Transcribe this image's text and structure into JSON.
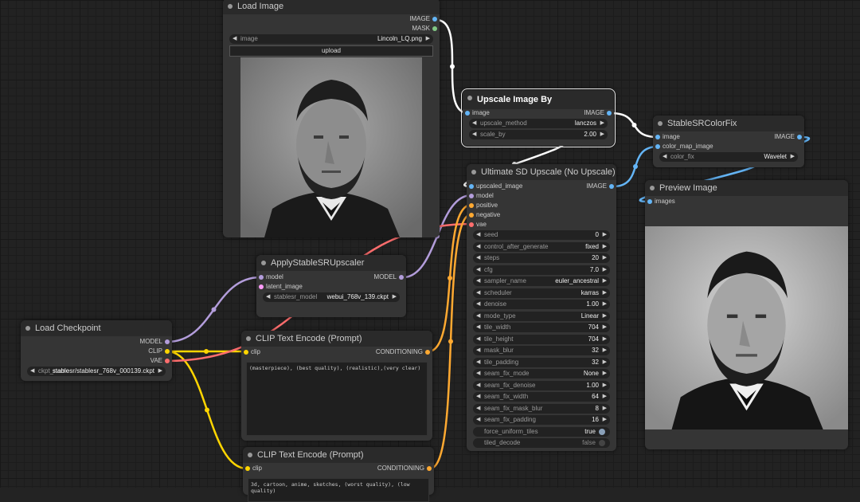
{
  "nodes": {
    "load_image": {
      "title": "Load Image",
      "outputs": [
        "IMAGE",
        "MASK"
      ],
      "image_widget": {
        "name": "image",
        "value": "Lincoln_LQ.png"
      },
      "upload_label": "upload"
    },
    "upscale_image_by": {
      "title": "Upscale Image By",
      "input": "image",
      "output": "IMAGE",
      "widgets": [
        {
          "name": "upscale_method",
          "value": "lanczos"
        },
        {
          "name": "scale_by",
          "value": "2.00"
        }
      ]
    },
    "stablesr_colorfix": {
      "title": "StableSRColorFix",
      "inputs": [
        "image",
        "color_map_image"
      ],
      "output": "IMAGE",
      "widget": {
        "name": "color_fix",
        "value": "Wavelet"
      }
    },
    "ultimate_sd_upscale": {
      "title": "Ultimate SD Upscale (No Upscale)",
      "inputs": [
        "upscaled_image",
        "model",
        "positive",
        "negative",
        "vae"
      ],
      "output": "IMAGE",
      "widgets": [
        {
          "name": "seed",
          "value": "0"
        },
        {
          "name": "control_after_generate",
          "value": "fixed"
        },
        {
          "name": "steps",
          "value": "20"
        },
        {
          "name": "cfg",
          "value": "7.0"
        },
        {
          "name": "sampler_name",
          "value": "euler_ancestral"
        },
        {
          "name": "scheduler",
          "value": "karras"
        },
        {
          "name": "denoise",
          "value": "1.00"
        },
        {
          "name": "mode_type",
          "value": "Linear"
        },
        {
          "name": "tile_width",
          "value": "704"
        },
        {
          "name": "tile_height",
          "value": "704"
        },
        {
          "name": "mask_blur",
          "value": "32"
        },
        {
          "name": "tile_padding",
          "value": "32"
        },
        {
          "name": "seam_fix_mode",
          "value": "None"
        },
        {
          "name": "seam_fix_denoise",
          "value": "1.00"
        },
        {
          "name": "seam_fix_width",
          "value": "64"
        },
        {
          "name": "seam_fix_mask_blur",
          "value": "8"
        },
        {
          "name": "seam_fix_padding",
          "value": "16"
        }
      ],
      "toggles": [
        {
          "name": "force_uniform_tiles",
          "value": "true"
        },
        {
          "name": "tiled_decode",
          "value": "false"
        }
      ]
    },
    "preview_image": {
      "title": "Preview Image",
      "input": "images"
    },
    "apply_stablesr": {
      "title": "ApplyStableSRUpscaler",
      "inputs": [
        "model",
        "latent_image"
      ],
      "output": "MODEL",
      "widget": {
        "name": "stablesr_model",
        "value": "webui_768v_139.ckpt"
      }
    },
    "load_checkpoint": {
      "title": "Load Checkpoint",
      "outputs": [
        "MODEL",
        "CLIP",
        "VAE"
      ],
      "widget": {
        "name": "ckpt_name",
        "value": "stablesr/stablesr_768v_000139.ckpt"
      }
    },
    "clip_pos": {
      "title": "CLIP Text Encode (Prompt)",
      "input": "clip",
      "output": "CONDITIONING",
      "text": "(masterpiece), (best quality), (realistic),(very clear)"
    },
    "clip_neg": {
      "title": "CLIP Text Encode (Prompt)",
      "input": "clip",
      "output": "CONDITIONING",
      "text": "3d, cartoon, anime, sketches, (worst quality), (low quality)"
    }
  },
  "colors": {
    "image": "#64b5f6",
    "model": "#b39ddb",
    "clip": "#ffd500",
    "vae": "#ff6e6e",
    "conditioning": "#ffa931",
    "latent": "#ff9cf9",
    "mask": "#81c784",
    "white_wire": "#ffffff"
  }
}
